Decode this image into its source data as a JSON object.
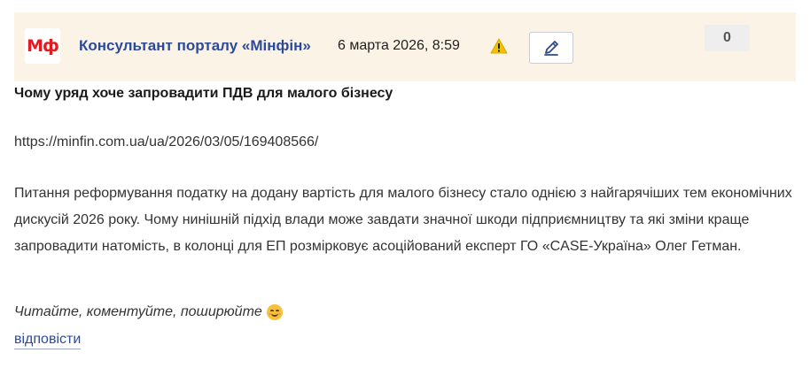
{
  "post": {
    "logo_text": "Мф",
    "author": "Консультант порталу «Мінфін»",
    "date": "6 марта 2026, 8:59",
    "warning_icon": "warning-icon",
    "edit_icon": "pencil-icon",
    "score": "0",
    "title": "Чому уряд хоче запровадити ПДВ для малого бізнесу",
    "url": "https://minfin.com.ua/ua/2026/03/05/169408566/",
    "body": "Питання реформування податку на додану вартість для малого бізнесу стало однією з найгарячіших тем економічних дискусій 2026 року. Чому нинішній підхід влади може завдати значної шкоди підприємництву та які зміни краще запровадити натомість, в колонці для ЕП розмірковує асоційований експерт ГО «CASE-Україна» Олег Гетман.",
    "cta": "Читайте, коментуйте, поширюйте",
    "cta_emoji": "smiling-face-icon",
    "reply_label": "відповісти"
  },
  "colors": {
    "header_bg": "#fbf3e6",
    "brand_red": "#e21b22",
    "link_blue": "#2d4a9a",
    "warning_yellow": "#f2c200"
  }
}
